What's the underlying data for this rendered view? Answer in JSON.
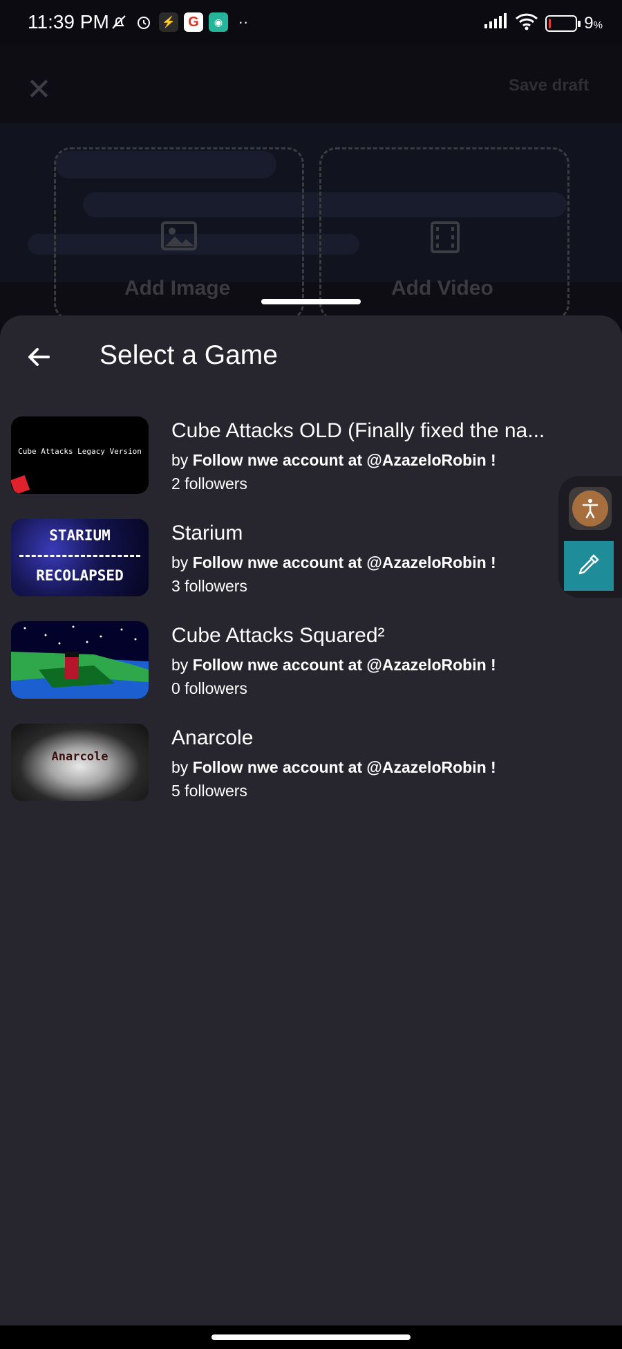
{
  "status_bar": {
    "time": "11:39 PM",
    "battery_text": "9",
    "battery_unit": "%",
    "battery_level": 0.09,
    "battery_color": "#e53935"
  },
  "backdrop": {
    "save_draft": "Save draft",
    "add_image": "Add Image",
    "add_video": "Add Video"
  },
  "sheet": {
    "title": "Select a Game",
    "by_prefix": "by",
    "games": [
      {
        "title": "Cube Attacks OLD (Finally fixed the na...",
        "author": "Follow nwe account at @AzazeloRobin !",
        "followers": "2 followers",
        "thumb_text": "Cube Attacks Legacy Version"
      },
      {
        "title": "Starium",
        "author": "Follow nwe account at @AzazeloRobin !",
        "followers": "3 followers",
        "thumb_text_top": "STARIUM",
        "thumb_text_bottom": "RECOLAPSED"
      },
      {
        "title": "Cube Attacks Squared²",
        "author": "Follow nwe account at @AzazeloRobin !",
        "followers": "0 followers"
      },
      {
        "title": "Anarcole",
        "author": "Follow nwe account at @AzazeloRobin !",
        "followers": "5 followers",
        "thumb_text": "Anarcole"
      }
    ]
  },
  "icons": {
    "back": "arrow-left-icon",
    "close": "close-icon",
    "accessibility": "accessibility-icon",
    "color_picker": "eyedropper-icon"
  },
  "colors": {
    "sheet_bg": "#27262e",
    "accent_teal": "#1f8d99",
    "accent_orange": "#a86f3e"
  }
}
